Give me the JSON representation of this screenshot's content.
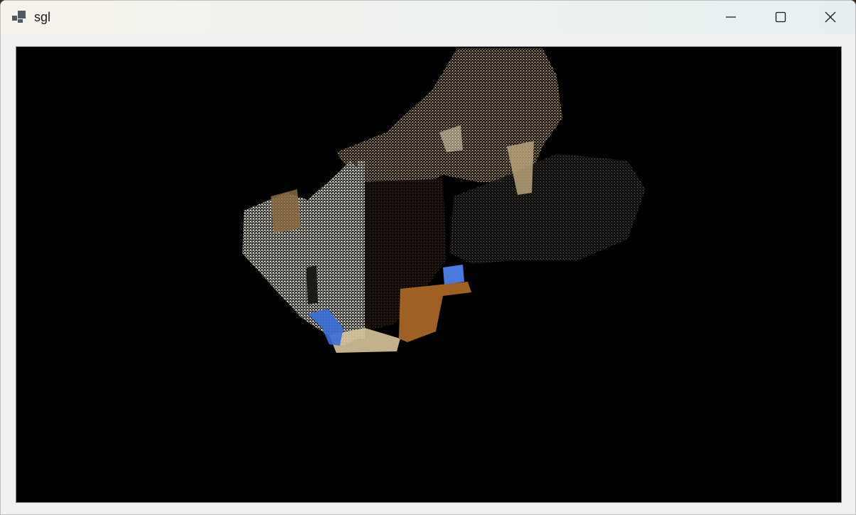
{
  "window": {
    "title": "sgl",
    "app_icon": "window-app-icon",
    "controls": {
      "minimize_icon": "minimize-icon",
      "maximize_icon": "maximize-icon",
      "close_icon": "close-icon"
    }
  },
  "viewport": {
    "content": "3d-point-cloud",
    "background": "#000000",
    "palette": {
      "wall_beige": "#c9b48a",
      "wall_white": "#e8e6d6",
      "dark_grey": "#4a4a44",
      "wood_orange": "#b06a28",
      "floor": "#d8c49a",
      "blue": "#3a6ed8"
    }
  }
}
